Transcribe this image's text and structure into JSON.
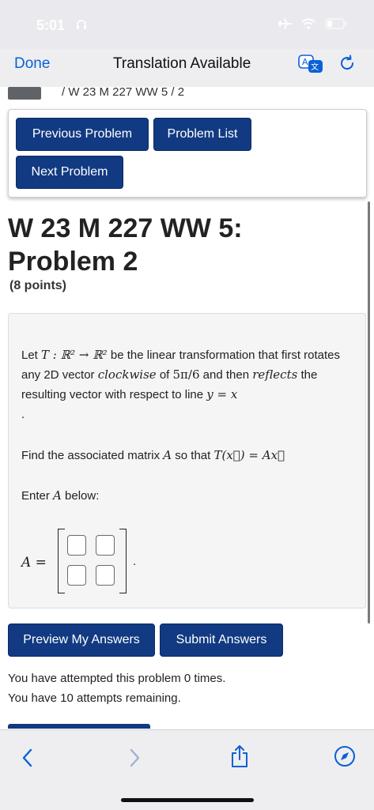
{
  "status": {
    "time": "5:01"
  },
  "nav": {
    "done_label": "Done",
    "title": "Translation Available"
  },
  "breadcrumb": "/ W 23 M 227 WW 5 / 2",
  "buttons": {
    "previous": "Previous Problem",
    "list": "Problem List",
    "next": "Next Problem",
    "preview": "Preview My Answers",
    "submit": "Submit Answers"
  },
  "problem": {
    "title": "W 23 M 227 WW 5: Problem 2",
    "points": "(8 points)",
    "intro_1": "Let ",
    "intro_2": " be the linear transformation that first rotates any 2D vector ",
    "word_clockwise": "clockwise",
    "intro_3": " of ",
    "intro_4": " and then ",
    "word_reflects": "reflects",
    "intro_5": " the resulting vector with respect to line ",
    "find_1": "Find the associated matrix ",
    "find_2": " so that ",
    "enter_1": "Enter ",
    "enter_2": " below:",
    "math_T": "T : ℝ² → ℝ²",
    "math_angle": "5π/6",
    "math_line": "y = x",
    "math_A": "A",
    "math_eq": "T(x⃗) = Ax⃗",
    "matrix_label": "A =",
    "matrix_cells": [
      "",
      "",
      "",
      ""
    ]
  },
  "attempts": {
    "line1": "You have attempted this problem 0 times.",
    "line2": "You have 10 attempts remaining."
  },
  "colors": {
    "accent": "#0a60d8",
    "button": "#123a82"
  }
}
